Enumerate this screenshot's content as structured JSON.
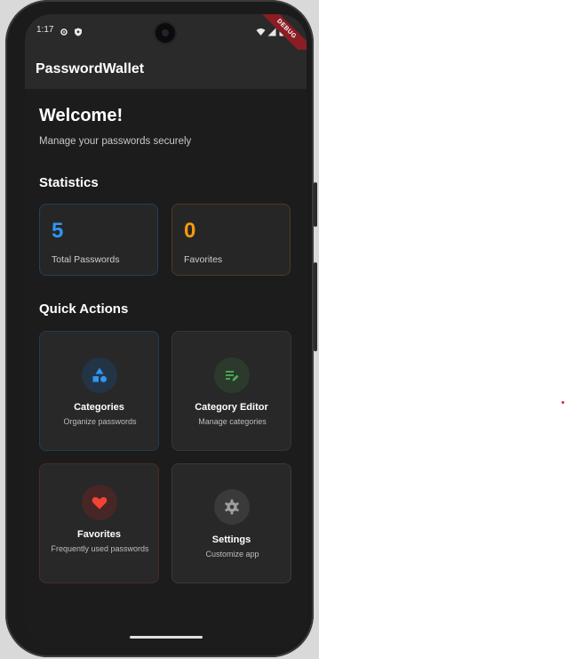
{
  "status": {
    "time": "1:17"
  },
  "debug_banner": "DEBUG",
  "appbar": {
    "title": "PasswordWallet"
  },
  "welcome": {
    "title": "Welcome!",
    "subtitle": "Manage your passwords securely"
  },
  "statistics": {
    "heading": "Statistics",
    "cards": [
      {
        "value": "5",
        "label": "Total Passwords",
        "color": "#2f96f3"
      },
      {
        "value": "0",
        "label": "Favorites",
        "color": "#f59a0c"
      }
    ]
  },
  "quick_actions": {
    "heading": "Quick Actions",
    "items": [
      {
        "title": "Categories",
        "subtitle": "Organize passwords",
        "icon": "category-icon",
        "color": "#2f96f3"
      },
      {
        "title": "Category Editor",
        "subtitle": "Manage categories",
        "icon": "edit-list-icon",
        "color": "#4caf50"
      },
      {
        "title": "Favorites",
        "subtitle": "Frequently used passwords",
        "icon": "heart-icon",
        "color": "#f44336"
      },
      {
        "title": "Settings",
        "subtitle": "Customize app",
        "icon": "gear-icon",
        "color": "#9e9e9e"
      }
    ]
  }
}
